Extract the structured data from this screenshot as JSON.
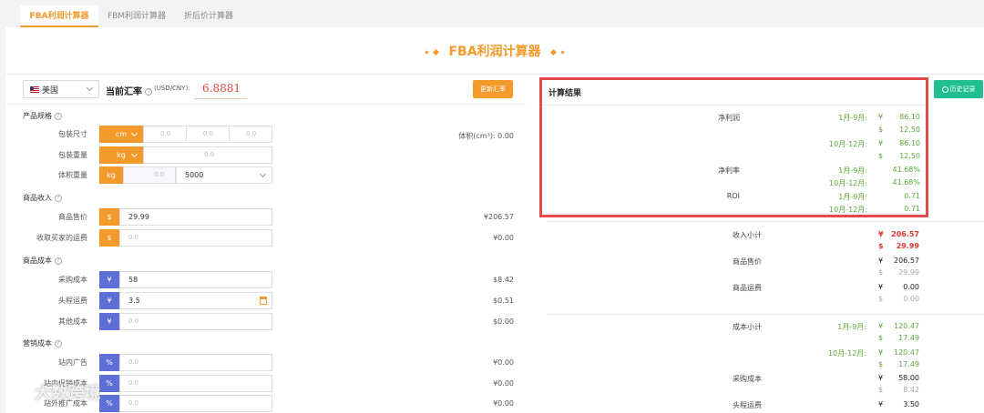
{
  "tabs": [
    {
      "label": "FBA利润计算器"
    },
    {
      "label": "FBM利润计算器"
    },
    {
      "label": "折后价计算器"
    }
  ],
  "hero": {
    "title": "FBA利润计算器"
  },
  "toolbar": {
    "country": "美国",
    "rate_label": "当前汇率",
    "rate_unit": "(USD/CNY):",
    "rate_value": "6.8881",
    "update_button": "更新汇率",
    "history_button": "历史记录"
  },
  "spec": {
    "section": "产品规格",
    "package_size_label": "包装尺寸",
    "size_unit": "cm",
    "size_dims": [
      "0.0",
      "0.0",
      "0.0"
    ],
    "weight_label": "包装重量",
    "weight_unit": "kg",
    "weight_placeholder": "0.0",
    "volume_weight_label": "体积重量",
    "volume_unit": "kg",
    "volume_value": "0.0",
    "divisor": "5000",
    "volume_text": "体积(cm³): 0.00"
  },
  "income": {
    "section": "商品收入",
    "rows": [
      {
        "label": "商品售价",
        "badge": "$",
        "value": "29.99",
        "amount": "¥206.57"
      },
      {
        "label": "收取买家的运费",
        "badge": "$",
        "value": "0.0",
        "amount": "¥0.00"
      }
    ]
  },
  "cost": {
    "section": "商品成本",
    "rows": [
      {
        "label": "采购成本",
        "badge": "¥",
        "value": "58",
        "amount": "$8.42"
      },
      {
        "label": "头程运费",
        "badge": "¥",
        "value": "3.5",
        "amount": "$0.51"
      },
      {
        "label": "其他成本",
        "badge": "¥",
        "value": "0.0",
        "amount": "$0.00"
      }
    ]
  },
  "marketing": {
    "section": "营销成本",
    "rows": [
      {
        "label": "站内广告",
        "badge": "%",
        "value": "0.0",
        "amount": "¥0.00"
      },
      {
        "label": "站内促销成本",
        "badge": "%",
        "value": "0.0",
        "amount": "¥0.00"
      },
      {
        "label": "站外推广成本",
        "badge": "%",
        "value": "0.0",
        "amount": "¥0.00"
      }
    ]
  },
  "result": {
    "title": "计算结果",
    "net_profit_label": "净利润",
    "net_profit": [
      {
        "period": "1月-9月:",
        "cny": "86.10",
        "usd": "12.50"
      },
      {
        "period": "10月-12月:",
        "cny": "86.10",
        "usd": "12.50"
      }
    ],
    "margin_label": "净利率",
    "margin": [
      {
        "period": "1月-9月:",
        "value": "41.68%"
      },
      {
        "period": "10月-12月:",
        "value": "41.68%"
      }
    ],
    "roi_label": "ROI",
    "roi": [
      {
        "period": "1月-9月:",
        "value": "0.71"
      },
      {
        "period": "10月-12月:",
        "value": "0.71"
      }
    ]
  },
  "details": {
    "income_subtotal_label": "收入小计",
    "income_subtotal": {
      "cny": "206.57",
      "usd": "29.99"
    },
    "sale_price_label": "商品售价",
    "sale_price": {
      "cny": "206.57",
      "usd": "29.99"
    },
    "shipping_label": "商品运费",
    "shipping": {
      "cny": "0.00",
      "usd": "0.00"
    },
    "cost_subtotal_label": "成本小计",
    "cost_subtotal": [
      {
        "period": "1月-9月:",
        "cny": "120.47",
        "usd": "17.49"
      },
      {
        "period": "10月-12月:",
        "cny": "120.47",
        "usd": "17.49"
      }
    ],
    "purchase_label": "采购成本",
    "purchase": {
      "cny": "58.00",
      "usd": "8.42"
    },
    "freight_label": "头程运费",
    "freight": {
      "cny": "3.50"
    }
  },
  "currency": {
    "cny": "¥",
    "usd": "$"
  },
  "watermark": "大数跨境",
  "colors": {
    "accent": "#f39a2b",
    "highlight": "#e64a4a",
    "profit": "#5aa93a",
    "history": "#1fbf8f",
    "badge_purple": "#5b6fd6"
  }
}
